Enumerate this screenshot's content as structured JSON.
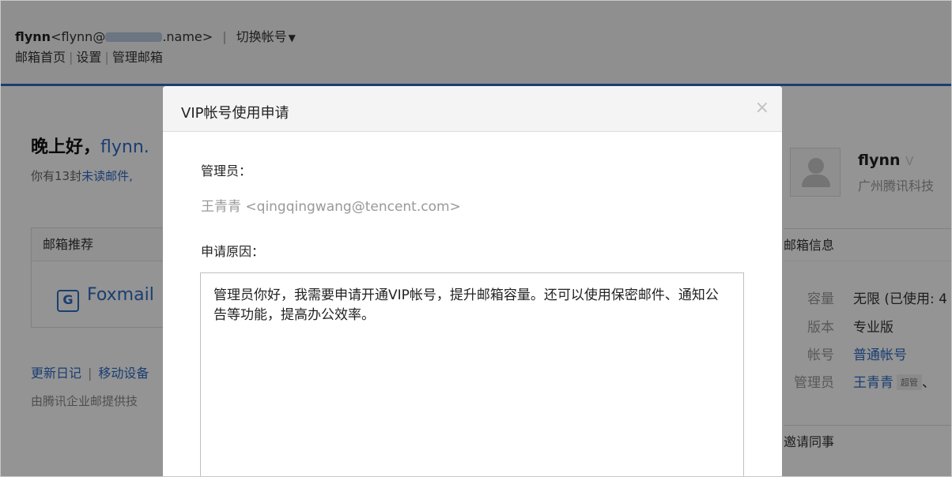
{
  "header": {
    "user_name": "flynn",
    "email_prefix": "<flynn@",
    "email_suffix": ".name>",
    "switch_label": "切换帐号",
    "links": [
      "邮箱首页",
      "设置",
      "管理邮箱"
    ]
  },
  "main": {
    "greeting": "晚上好，",
    "greeting_name": "flynn.",
    "unread_prefix": "你有13封",
    "unread_link": "未读邮件,",
    "recommend_title": "邮箱推荐",
    "foxmail_label": "Foxmail",
    "foot_links": [
      "更新日记",
      "移动设备"
    ],
    "foot_text": "由腾讯企业邮提供技"
  },
  "profile": {
    "name": "flynn",
    "org": "广州腾讯科技"
  },
  "mailbox_info": {
    "title": "邮箱信息",
    "capacity_key": "容量",
    "capacity_val": "无限 (已使用: 4",
    "version_key": "版本",
    "version_val": "专业版",
    "account_key": "帐号",
    "account_val": "普通帐号",
    "admin_key": "管理员",
    "admin_val": "王青青",
    "admin_tag": "超管",
    "admin_more": "、",
    "invite_title": "邀请同事"
  },
  "dialog": {
    "title": "VIP帐号使用申请",
    "close_symbol": "×",
    "admin_label": "管理员：",
    "admin_value": "王青青 <qingqingwang@tencent.com>",
    "reason_label": "申请原因：",
    "reason_text": "管理员你好，我需要申请开通VIP帐号，提升邮箱容量。还可以使用保密邮件、通知公告等功能，提高办公效率。"
  }
}
